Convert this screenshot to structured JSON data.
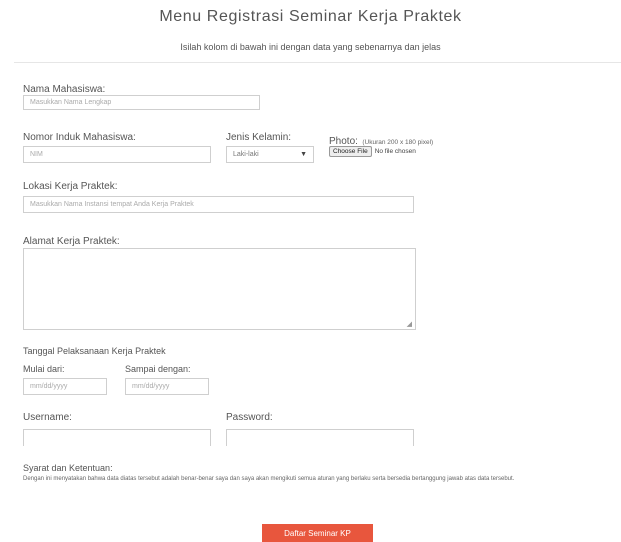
{
  "header": {
    "title": "Menu Registrasi Seminar Kerja Praktek",
    "subtitle": "Isilah kolom di bawah ini dengan data yang sebenarnya dan jelas"
  },
  "form": {
    "nama": {
      "label": "Nama Mahasiswa:",
      "placeholder": "Masukkan Nama Lengkap"
    },
    "nim": {
      "label": "Nomor Induk Mahasiswa:",
      "placeholder": "NIM"
    },
    "jenis_kelamin": {
      "label": "Jenis Kelamin:",
      "value": "Laki-laki"
    },
    "photo": {
      "label": "Photo:",
      "hint": "(Ukuran 200 x 180 pixel)",
      "button": "Choose File",
      "status": "No file chosen"
    },
    "lokasi": {
      "label": "Lokasi Kerja Praktek:",
      "placeholder": "Masukkan Nama Instansi tempat Anda Kerja Praktek"
    },
    "alamat": {
      "label": "Alamat Kerja Praktek:"
    },
    "tanggal": {
      "label": "Tanggal Pelaksanaan Kerja Praktek",
      "mulai_label": "Mulai dari:",
      "mulai_placeholder": "mm/dd/yyyy",
      "sampai_label": "Sampai dengan:",
      "sampai_placeholder": "mm/dd/yyyy"
    },
    "username": {
      "label": "Username:"
    },
    "password": {
      "label": "Password:"
    },
    "syarat": {
      "label": "Syarat dan Ketentuan:",
      "text": "Dengan ini menyatakan bahwa data diatas tersebut adalah benar-benar saya dan saya akan mengikuti semua aturan yang berlaku serta bersedia bertanggung jawab atas data tersebut."
    },
    "submit": "Daftar Seminar KP"
  },
  "colors": {
    "accent": "#e8563d"
  }
}
